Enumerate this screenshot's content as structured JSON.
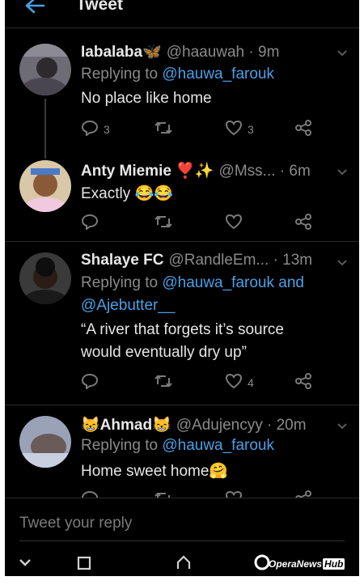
{
  "header": {
    "title": "Tweet"
  },
  "tweets": [
    {
      "name": "Iabalaba",
      "name_emoji": "🦋",
      "handle": "@haauwah",
      "time": "· 9m",
      "replying_prefix": "Replying to ",
      "replying_to": "@hauwa_farouk",
      "replying_to_2": "",
      "text_lines": [
        "No place like home"
      ],
      "counts": {
        "replies": "3",
        "retweets": "",
        "likes": "3"
      }
    },
    {
      "name": "Anty Miemie",
      "name_emoji": "❣️✨",
      "handle": "@Mss...",
      "time": "· 6m",
      "text_lines": [
        "Exactly 😂😂"
      ],
      "counts": {
        "replies": "",
        "retweets": "",
        "likes": ""
      }
    },
    {
      "name": "Shalaye FC",
      "handle": "@RandleEm...",
      "time": "· 13m",
      "replying_prefix": "Replying to ",
      "replying_to": "@hauwa_farouk and",
      "replying_to_2": "@Ajebutter__",
      "text_lines": [
        "“A river that forgets it’s source",
        "would eventually dry up”"
      ],
      "counts": {
        "replies": "",
        "retweets": "",
        "likes": "4"
      }
    },
    {
      "name": "Ahmad",
      "name_emoji": "😸",
      "handle": "@Adujencyy",
      "time": "· 20m",
      "replying_prefix": "Replying to ",
      "replying_to": "@hauwa_farouk",
      "text_lines": [
        "Home sweet home🤗"
      ]
    }
  ],
  "composer": {
    "placeholder": "Tweet your reply"
  },
  "watermark": {
    "text": "OperaNews",
    "badge": "Hub"
  },
  "colors": {
    "background": "#000000",
    "link": "#4a9fe6",
    "muted": "#8a8a8a",
    "text": "#e6e6e6"
  }
}
